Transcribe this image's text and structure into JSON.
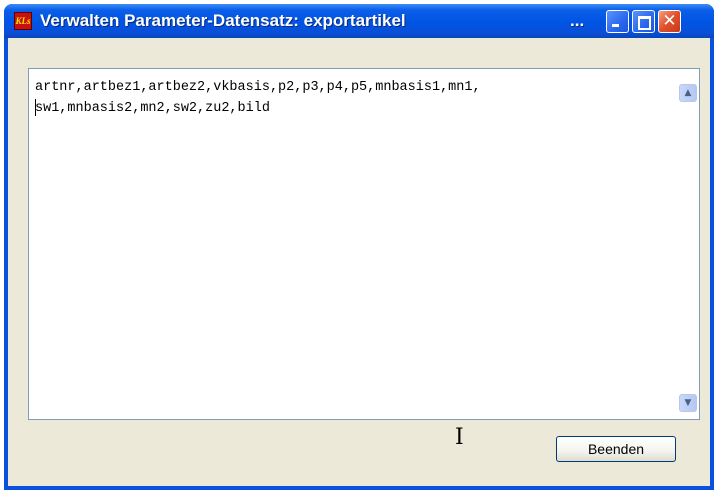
{
  "window": {
    "title": "Verwalten Parameter-Datensatz: exportartikel",
    "title_ellipsis": "...",
    "app_icon_label": "KLs",
    "close_glyph": "✕"
  },
  "editor": {
    "lines": [
      "artnr,artbez1,artbez2,vkbasis,p2,p3,p4,p5,mnbasis1,mn1,",
      "sw1,mnbasis2,mn2,sw2,zu2,bild"
    ],
    "scroll_up": "▲",
    "scroll_down": "▼"
  },
  "buttons": {
    "close_label": "Beenden"
  },
  "cursor": {
    "glyph": "I"
  },
  "colors": {
    "titlebar": "#0054e3",
    "dialog_bg": "#ece9d8",
    "close_button": "#e0502a",
    "textarea_border": "#7f9db9"
  }
}
